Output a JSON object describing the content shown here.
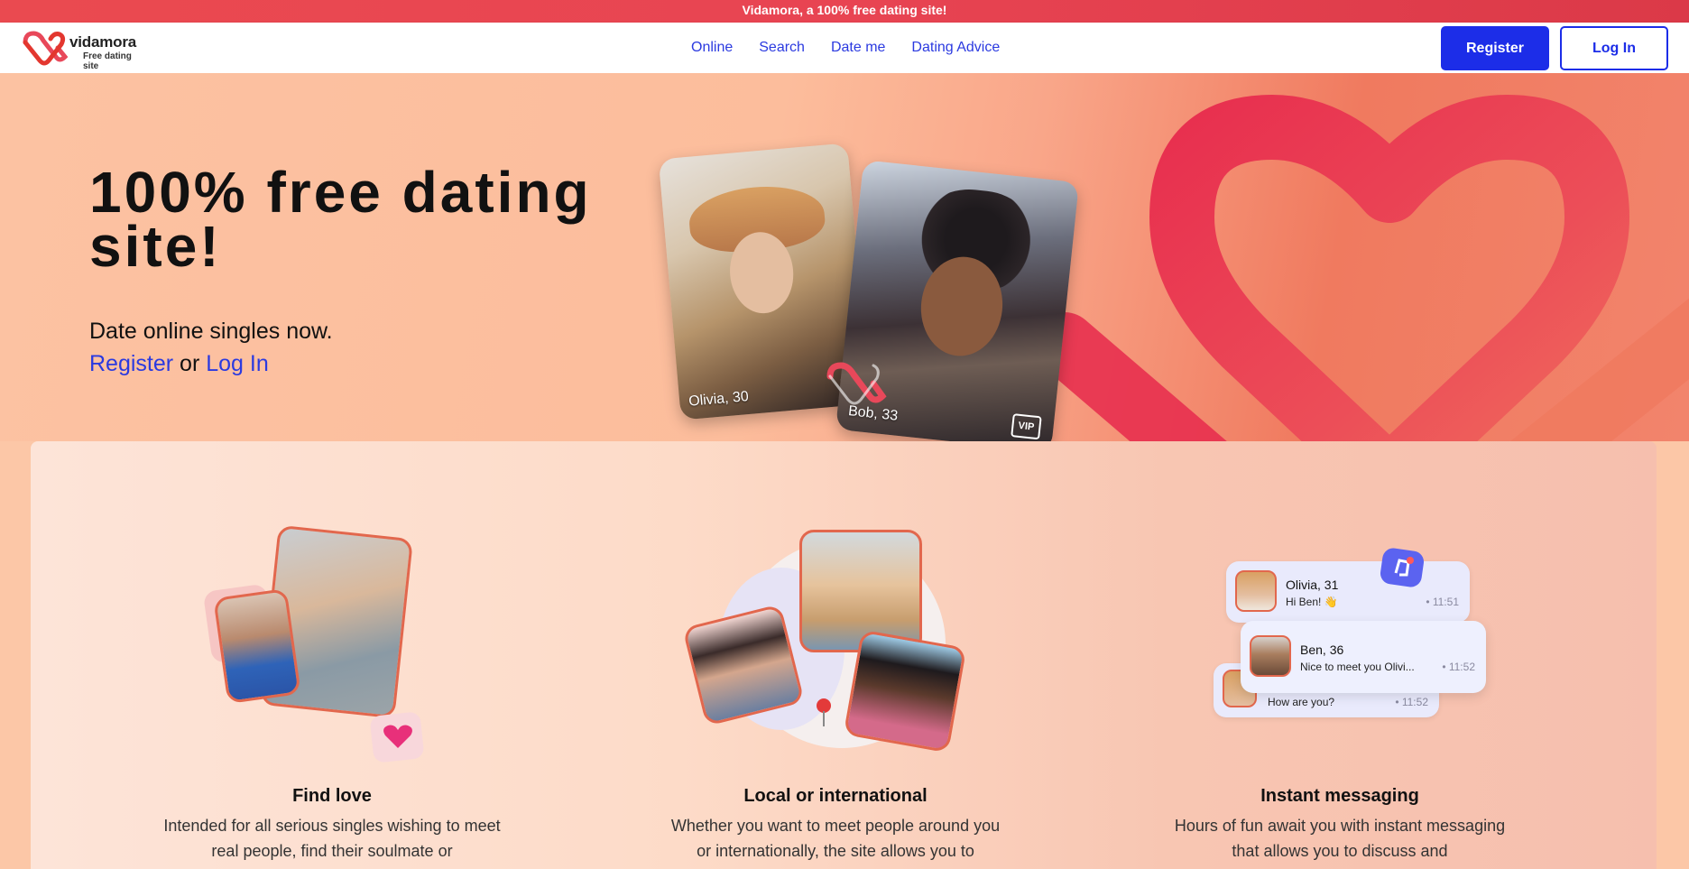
{
  "banner": {
    "text": "Vidamora, a 100% free dating site!"
  },
  "header": {
    "logo_name": "vidamora",
    "logo_tagline": "Free dating site",
    "nav": [
      "Online",
      "Search",
      "Date me",
      "Dating Advice"
    ],
    "register_label": "Register",
    "login_label": "Log In"
  },
  "hero": {
    "title": "100% free dating site!",
    "subtitle": "Date online singles now.",
    "cta_register": "Register",
    "cta_or": "or",
    "cta_login": "Log In",
    "profiles": [
      {
        "label": "Olivia, 30",
        "badge": "verified-badge-icon"
      },
      {
        "label": "Bob, 33",
        "badge": "VIP"
      }
    ]
  },
  "features": [
    {
      "title": "Find love",
      "desc": "Intended for all serious singles wishing to meet real people, find their soulmate or"
    },
    {
      "title": "Local or international",
      "desc": "Whether you want to meet people around you or internationally, the site allows you to"
    },
    {
      "title": "Instant messaging",
      "desc": "Hours of fun await you with instant messaging that allows you to discuss and"
    }
  ],
  "chats": [
    {
      "name": "Olivia, 31",
      "msg": "Hi Ben! 👋",
      "time": "• 11:51"
    },
    {
      "name": "Ben, 36",
      "msg": "Nice to meet you Olivi...",
      "time": "• 11:52"
    },
    {
      "name": "",
      "msg": "How are you?",
      "time": "• 11:52"
    }
  ],
  "colors": {
    "brand_blue": "#1c2de8",
    "accent_red": "#e8485a",
    "coral": "#e2674d"
  }
}
